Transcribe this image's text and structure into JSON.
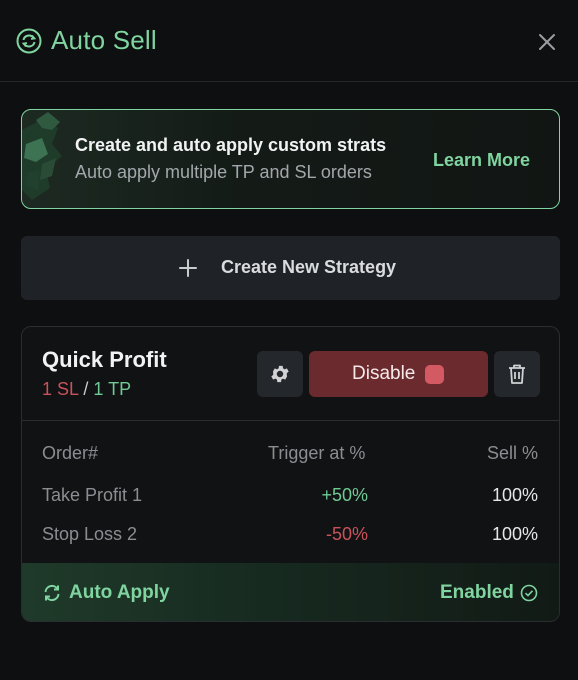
{
  "header": {
    "title": "Auto Sell",
    "close_icon": "close-icon",
    "title_icon": "refresh-circle-icon"
  },
  "promo": {
    "title": "Create and auto apply custom strats",
    "subtitle": "Auto apply multiple TP and SL orders",
    "link": "Learn More"
  },
  "create": {
    "label": "Create New Strategy",
    "icon": "plus-icon"
  },
  "strategy": {
    "name": "Quick Profit",
    "sl_count": "1 SL",
    "separator": "/",
    "tp_count": "1 TP",
    "disable_label": "Disable",
    "columns": [
      "Order#",
      "Trigger at %",
      "Sell %"
    ],
    "rows": [
      {
        "order": "Take Profit 1",
        "trigger": "+50%",
        "sell": "100%"
      },
      {
        "order": "Stop Loss 2",
        "trigger": "-50%",
        "sell": "100%"
      }
    ],
    "footer": {
      "auto_apply": "Auto Apply",
      "status": "Enabled"
    }
  },
  "colors": {
    "accent": "#7fd4a0",
    "danger": "#c8535a",
    "disable_bg": "#6b2a2e",
    "background": "#0e0f10"
  }
}
